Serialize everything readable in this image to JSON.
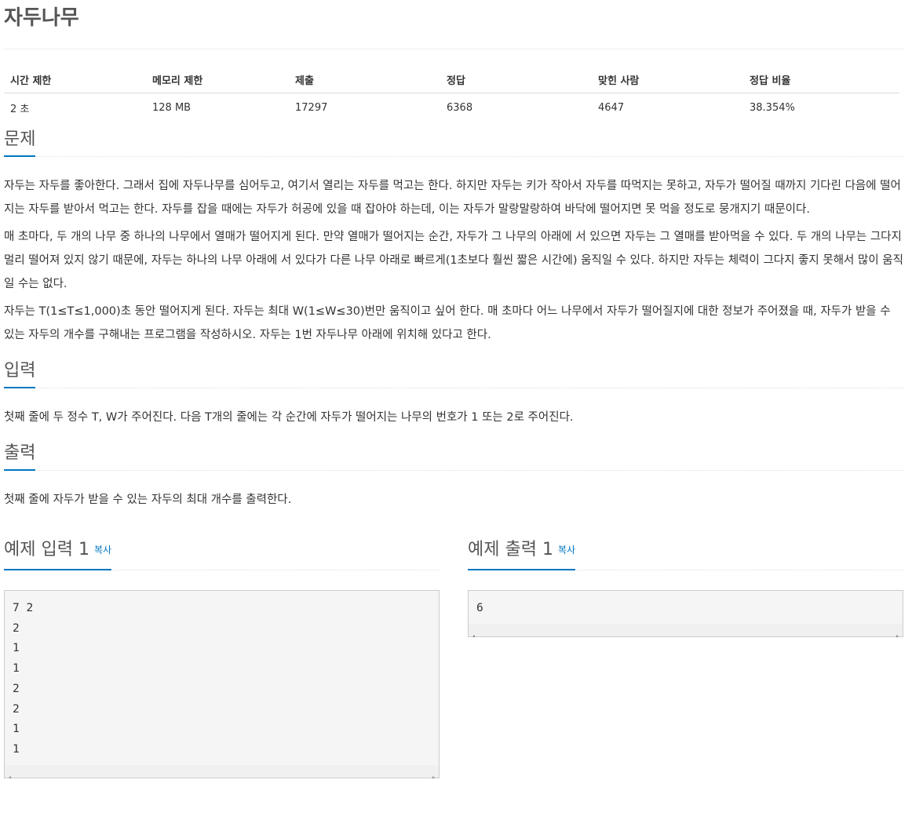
{
  "title": "자두나무",
  "info_table": {
    "headers": [
      "시간 제한",
      "메모리 제한",
      "제출",
      "정답",
      "맞힌 사람",
      "정답 비율"
    ],
    "values": [
      "2 초",
      "128 MB",
      "17297",
      "6368",
      "4647",
      "38.354%"
    ]
  },
  "problem": {
    "heading": "문제",
    "paragraphs": [
      "자두는 자두를 좋아한다. 그래서 집에 자두나무를 심어두고, 여기서 열리는 자두를 먹고는 한다. 하지만 자두는 키가 작아서 자두를 따먹지는 못하고, 자두가 떨어질 때까지 기다린 다음에 떨어지는 자두를 받아서 먹고는 한다. 자두를 잡을 때에는 자두가 허공에 있을 때 잡아야 하는데, 이는 자두가 말랑말랑하여 바닥에 떨어지면 못 먹을 정도로 뭉개지기 때문이다.",
      "매 초마다, 두 개의 나무 중 하나의 나무에서 열매가 떨어지게 된다. 만약 열매가 떨어지는 순간, 자두가 그 나무의 아래에 서 있으면 자두는 그 열매를 받아먹을 수 있다. 두 개의 나무는 그다지 멀리 떨어져 있지 않기 때문에, 자두는 하나의 나무 아래에 서 있다가 다른 나무 아래로 빠르게(1초보다 훨씬 짧은 시간에) 움직일 수 있다. 하지만 자두는 체력이 그다지 좋지 못해서 많이 움직일 수는 없다.",
      "자두는 T(1≤T≤1,000)초 동안 떨어지게 된다. 자두는 최대 W(1≤W≤30)번만 움직이고 싶어 한다. 매 초마다 어느 나무에서 자두가 떨어질지에 대한 정보가 주어졌을 때, 자두가 받을 수 있는 자두의 개수를 구해내는 프로그램을 작성하시오. 자두는 1번 자두나무 아래에 위치해 있다고 한다."
    ]
  },
  "input": {
    "heading": "입력",
    "text": "첫째 줄에 두 정수 T, W가 주어진다. 다음 T개의 줄에는 각 순간에 자두가 떨어지는 나무의 번호가 1 또는 2로 주어진다."
  },
  "output": {
    "heading": "출력",
    "text": "첫째 줄에 자두가 받을 수 있는 자두의 최대 개수를 출력한다."
  },
  "sample_input": {
    "heading": "예제 입력 1",
    "copy_label": "복사",
    "content": "7 2\n2\n1\n1\n2\n2\n1\n1"
  },
  "sample_output": {
    "heading": "예제 출력 1",
    "copy_label": "복사",
    "content": "6"
  },
  "scroll": {
    "left_arrow": "◂",
    "right_arrow": "▸"
  }
}
